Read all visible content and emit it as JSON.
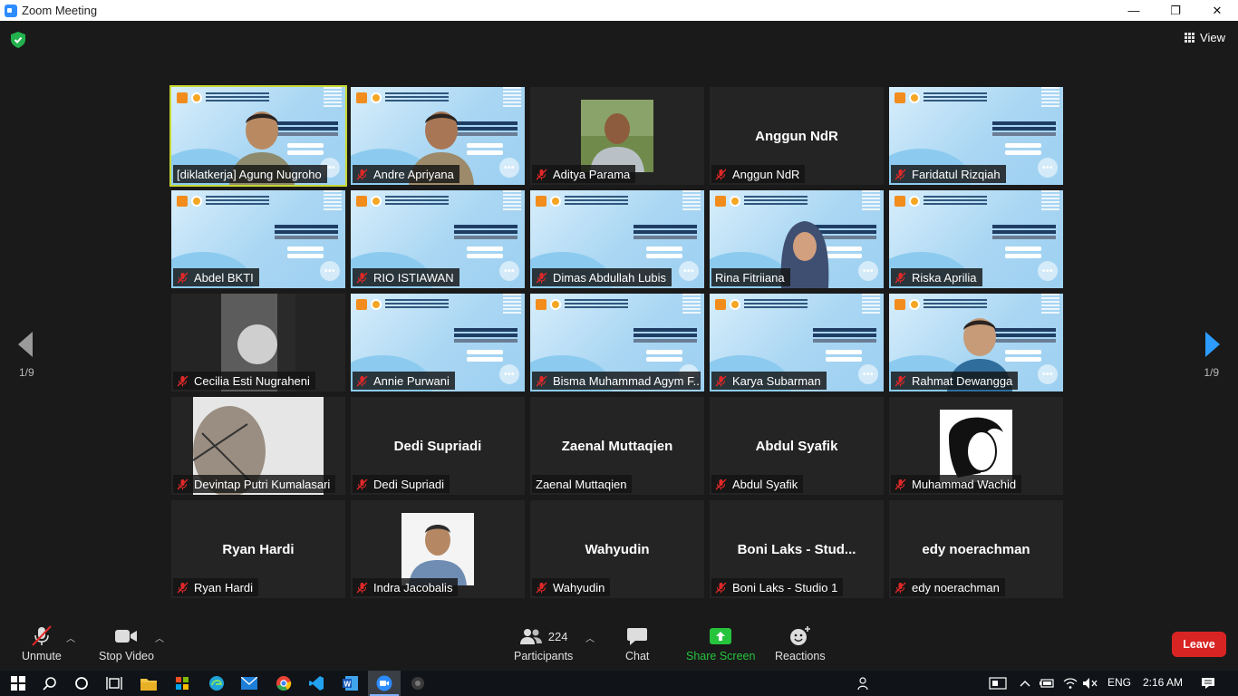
{
  "window": {
    "title": "Zoom Meeting",
    "controls": [
      "—",
      "❐",
      "✕"
    ]
  },
  "top": {
    "view_label": "View"
  },
  "pagination": {
    "prev": "1/9",
    "next": "1/9"
  },
  "participants": [
    {
      "name": "[diklatkerja] Agung Nugroho",
      "kind": "video-slide-person",
      "active": true,
      "muted": false
    },
    {
      "name": "Andre Apriyana",
      "kind": "video-slide-person",
      "muted": true
    },
    {
      "name": "Aditya Parama",
      "kind": "photo",
      "muted": true
    },
    {
      "name": "Anggun NdR",
      "kind": "name",
      "muted": true,
      "big": "Anggun NdR"
    },
    {
      "name": "Faridatul Rizqiah",
      "kind": "slide",
      "muted": true
    },
    {
      "name": "Abdel BKTI",
      "kind": "slide",
      "muted": true
    },
    {
      "name": "RIO ISTIAWAN",
      "kind": "slide",
      "muted": true
    },
    {
      "name": "Dimas Abdullah Lubis",
      "kind": "slide",
      "muted": true
    },
    {
      "name": "Rina Fitriiana",
      "kind": "video-slide-person",
      "muted": false
    },
    {
      "name": "Riska Aprilia",
      "kind": "slide",
      "muted": true
    },
    {
      "name": "Cecilia Esti Nugraheni",
      "kind": "photo-dark",
      "muted": true
    },
    {
      "name": "Annie Purwani",
      "kind": "slide",
      "muted": true
    },
    {
      "name": "Bisma Muhammad Agym F...",
      "kind": "slide",
      "muted": true
    },
    {
      "name": "Karya Subarman",
      "kind": "slide",
      "muted": true
    },
    {
      "name": "Rahmat Dewangga",
      "kind": "video-slide-person",
      "muted": true
    },
    {
      "name": "Devintap Putri Kumalasari",
      "kind": "photo-light",
      "muted": true
    },
    {
      "name": "Dedi Supriadi",
      "kind": "name",
      "muted": true,
      "big": "Dedi Supriadi"
    },
    {
      "name": "Zaenal Muttaqien",
      "kind": "name",
      "muted": false,
      "big": "Zaenal Muttaqien"
    },
    {
      "name": "Abdul Syafik",
      "kind": "name",
      "muted": true,
      "big": "Abdul Syafik"
    },
    {
      "name": "Muhammad Wachid",
      "kind": "photo-sketch",
      "muted": true
    },
    {
      "name": "Ryan Hardi",
      "kind": "name",
      "muted": true,
      "big": "Ryan Hardi"
    },
    {
      "name": "Indra Jacobalis",
      "kind": "photo-passport",
      "muted": true
    },
    {
      "name": "Wahyudin",
      "kind": "name",
      "muted": true,
      "big": "Wahyudin"
    },
    {
      "name": "Boni Laks - Studio 1",
      "kind": "name",
      "muted": true,
      "big": "Boni Laks - Stud..."
    },
    {
      "name": "edy noerachman",
      "kind": "name",
      "muted": true,
      "big": "edy noerachman"
    }
  ],
  "toolbar": {
    "unmute": "Unmute",
    "stop_video": "Stop Video",
    "participants": "Participants",
    "participants_count": "224",
    "chat": "Chat",
    "share_screen": "Share Screen",
    "reactions": "Reactions",
    "leave": "Leave"
  },
  "taskbar": {
    "lang": "ENG",
    "time": "2:16 AM"
  },
  "colors": {
    "accent_green": "#26c43d",
    "leave_red": "#d92424",
    "active_border": "#c8d832",
    "mute_red": "#e02828"
  }
}
